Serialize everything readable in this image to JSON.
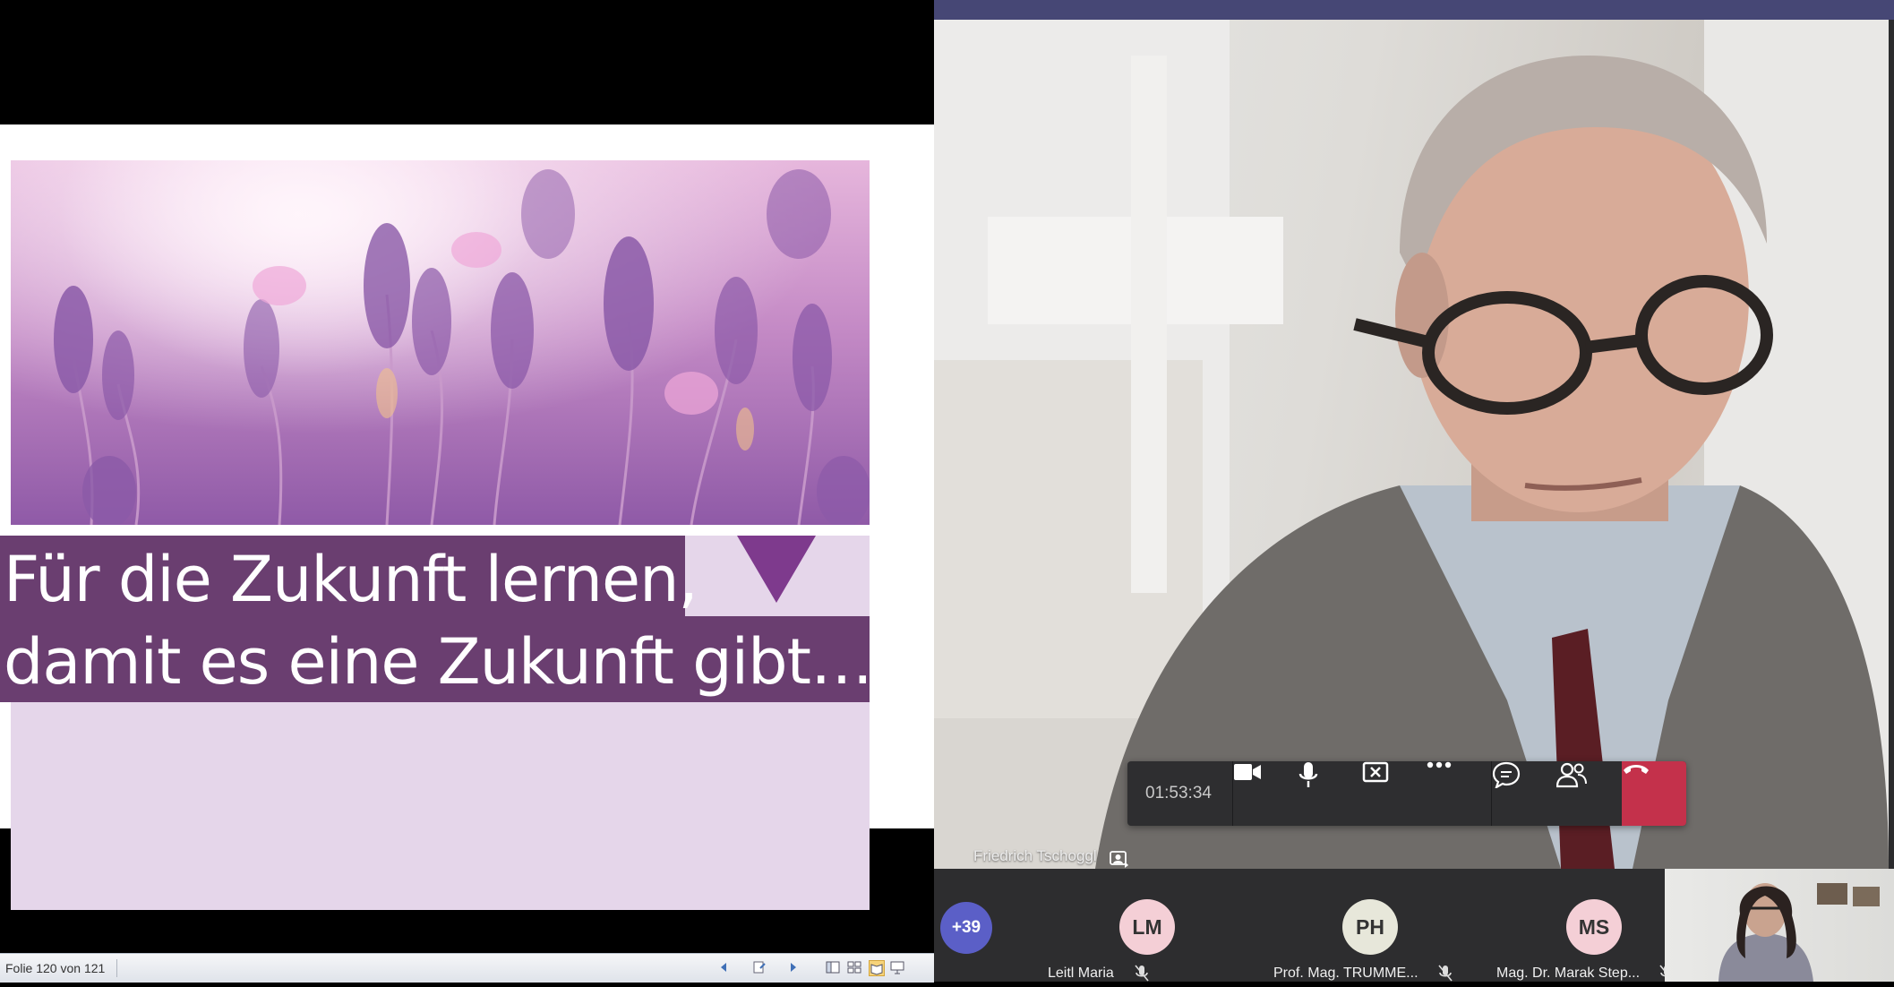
{
  "presentation": {
    "slide_title_line1": "Für die Zukunft lernen,",
    "slide_title_line2": "damit es eine Zukunft gibt…",
    "status_counter": "Folie 120 von 121",
    "icons": [
      "prev-slide-icon",
      "notes-icon",
      "next-slide-icon",
      "normal-view-icon",
      "slide-sorter-icon",
      "reading-view-icon",
      "slideshow-icon"
    ]
  },
  "meeting": {
    "call_duration": "01:53:34",
    "controls": [
      "camera-icon",
      "microphone-icon",
      "stop-share-icon",
      "more-options-icon",
      "chat-icon",
      "participants-icon",
      "hang-up-icon"
    ],
    "active_speaker": "Friedrich Tschoggl",
    "overflow_count": "+39",
    "participants": [
      {
        "initials": "LM",
        "name": "Leitl Maria",
        "avatar_color": "#f4cfd6"
      },
      {
        "initials": "PH",
        "name": "Prof. Mag. TRUMME...",
        "avatar_color": "#e7e7da"
      },
      {
        "initials": "MS",
        "name": "Mag. Dr. Marak Step...",
        "avatar_color": "#f4cfd6"
      }
    ]
  },
  "colors": {
    "teams_accent": "#464775",
    "hangup": "#c4314b",
    "slide_purple": "#6a3e70",
    "slide_lilac": "#e5d6ea"
  }
}
